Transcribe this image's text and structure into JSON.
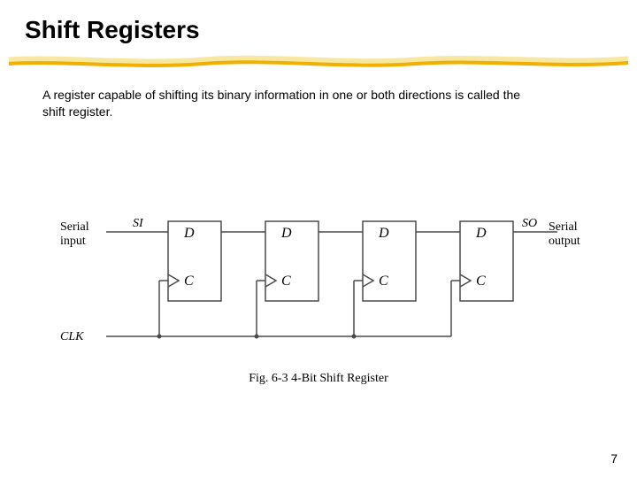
{
  "slide": {
    "title": "Shift Registers",
    "body": "A register capable of shifting its binary information in one or both directions is called the shift register.",
    "page_number": "7"
  },
  "diagram": {
    "left_label_line1": "Serial",
    "left_label_line2": "input",
    "right_label_line1": "Serial",
    "right_label_line2": "output",
    "si": "SI",
    "so": "SO",
    "clk": "CLK",
    "ff": {
      "d": "D",
      "c": "C"
    },
    "caption": "Fig. 6-3  4-Bit Shift Register"
  },
  "colors": {
    "stroke_gold": "#f0b000",
    "stroke_cream": "#f7e7a0"
  }
}
